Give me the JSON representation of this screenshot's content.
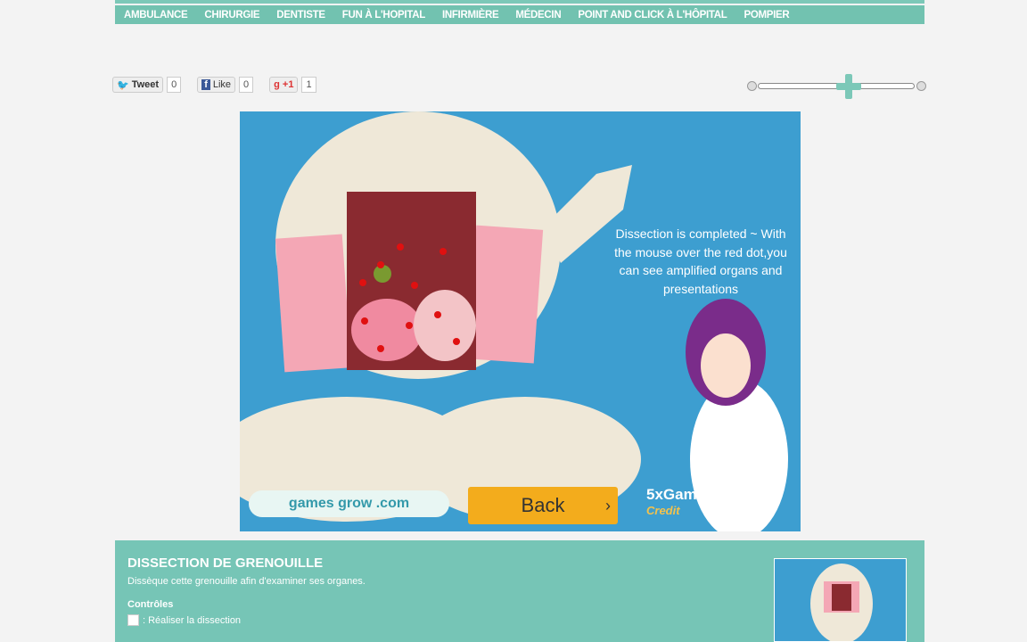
{
  "nav": {
    "items": [
      "AMBULANCE",
      "CHIRURGIE",
      "DENTISTE",
      "FUN À L'HOPITAL",
      "INFIRMIÈRE",
      "MÉDECIN",
      "POINT AND CLICK À L'HÔPITAL",
      "POMPIER"
    ]
  },
  "social": {
    "tweet": "Tweet",
    "tweet_count": "0",
    "like": "Like",
    "like_count": "0",
    "plus": "+1",
    "plus_count": "1"
  },
  "zoom_level": 0.58,
  "game": {
    "message": "Dissection is completed ~ With the mouse over the red dot,you can see amplified organs and presentations",
    "back": "Back",
    "gamesgrow": "games grow .com",
    "credit_brand": "5xGame.com",
    "credit_label": "Credit"
  },
  "info": {
    "title": "DISSECTION DE GRENOUILLE",
    "description": "Dissèque cette grenouille afin d'examiner ses organes.",
    "controls_label": "Contrôles",
    "control_text": ": Réaliser la dissection"
  },
  "colors": {
    "accent": "#72c2b0",
    "game_bg": "#3d9ed0",
    "back_button": "#f3ac1c"
  }
}
